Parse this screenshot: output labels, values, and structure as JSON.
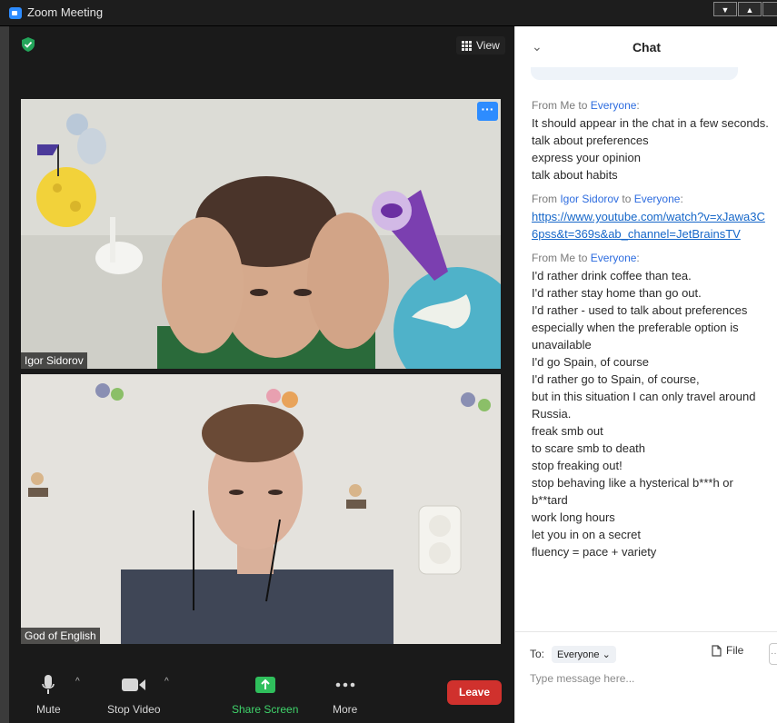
{
  "window": {
    "title": "Zoom Meeting",
    "min_glyph": "▼",
    "max_glyph": "▲"
  },
  "meeting": {
    "view_label": "View",
    "participants": [
      {
        "name": "Igor Sidorov"
      },
      {
        "name": "God of English"
      }
    ]
  },
  "toolbar": {
    "mute_label": "Mute",
    "stop_video_label": "Stop Video",
    "share_screen_label": "Share Screen",
    "more_label": "More",
    "leave_label": "Leave"
  },
  "chat": {
    "title": "Chat",
    "messages": [
      {
        "sender": "Me",
        "to_word": "to",
        "recipient": "Everyone",
        "lines": [
          "It should appear in the chat in a few seconds.",
          "talk about preferences",
          "express your opinion",
          "talk about habits"
        ]
      },
      {
        "sender": "Igor Sidorov",
        "to_word": "to",
        "recipient": "Everyone",
        "link": "https://www.youtube.com/watch?v=xJawa3C6pss&t=369s&ab_channel=JetBrainsTV"
      },
      {
        "sender": "Me",
        "to_word": "to",
        "recipient": "Everyone",
        "lines": [
          "I'd rather drink coffee than tea.",
          "I'd rather stay home than go out.",
          "I'd rather - used to talk about preferences",
          "especially when the preferable option is unavailable",
          "I'd go Spain, of course",
          "I'd rather go to Spain, of course,",
          "but in this situation I can only travel around Russia.",
          "freak smb out",
          "to scare smb to death",
          "stop freaking out!",
          "stop behaving like a hysterical b***h or b**tard",
          "work long hours",
          "let you in on a secret",
          "fluency = pace + variety"
        ]
      }
    ],
    "to_label": "To:",
    "to_value": "Everyone",
    "file_label": "File",
    "input_placeholder": "Type message here..."
  },
  "colors": {
    "meeting_bg": "#1a1a1a",
    "accent_blue": "#2d8cff",
    "share_green": "#3fd46b",
    "leave_red": "#d0312d",
    "link_blue": "#1667c9"
  }
}
